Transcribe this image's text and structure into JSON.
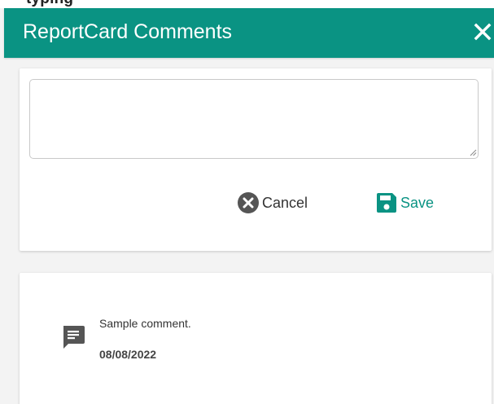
{
  "background": {
    "partial_text": "typing"
  },
  "dialog": {
    "title": "ReportCard Comments",
    "close_icon": "close-icon"
  },
  "editor": {
    "comment_value": "",
    "cancel_label": "Cancel",
    "save_label": "Save",
    "cancel_icon": "cancel-circle-icon",
    "save_icon": "floppy-disk-icon"
  },
  "comments": [
    {
      "text": "Sample comment.",
      "date": "08/08/2022",
      "icon": "comment-icon"
    }
  ],
  "colors": {
    "accent": "#0a9383",
    "header_text": "#ffffff",
    "cancel_icon": "#555555"
  }
}
